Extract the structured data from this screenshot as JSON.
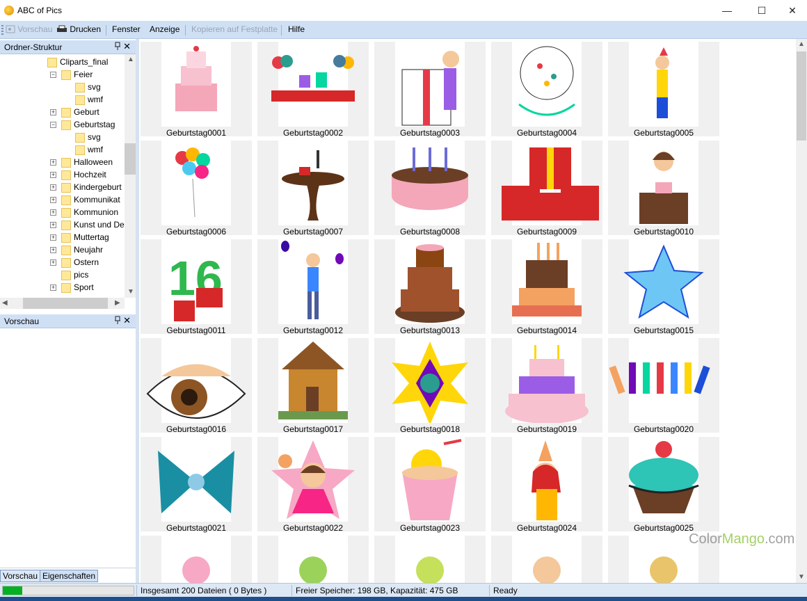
{
  "window": {
    "title": "ABC of Pics",
    "minimize_glyph": "—",
    "maximize_glyph": "☐",
    "close_glyph": "✕"
  },
  "menu": {
    "preview": "Vorschau",
    "print": "Drucken",
    "window": "Fenster",
    "view": "Anzeige",
    "copy_to_disk": "Kopieren auf Festplatte",
    "help": "Hilfe"
  },
  "folder_panel": {
    "title": "Ordner-Struktur",
    "pin_glyph": "📌",
    "close_glyph": "✕",
    "tree": [
      {
        "label": "Cliparts_final",
        "expander": ""
      },
      {
        "label": "Feier",
        "expander": "−"
      },
      {
        "label": "svg",
        "expander": ""
      },
      {
        "label": "wmf",
        "expander": ""
      },
      {
        "label": "Geburt",
        "expander": "+"
      },
      {
        "label": "Geburtstag",
        "expander": "−"
      },
      {
        "label": "svg",
        "expander": ""
      },
      {
        "label": "wmf",
        "expander": ""
      },
      {
        "label": "Halloween",
        "expander": "+"
      },
      {
        "label": "Hochzeit",
        "expander": "+"
      },
      {
        "label": "Kindergeburt",
        "expander": "+"
      },
      {
        "label": "Kommunikat",
        "expander": "+"
      },
      {
        "label": "Kommunion",
        "expander": "+"
      },
      {
        "label": "Kunst und De",
        "expander": "+"
      },
      {
        "label": "Muttertag",
        "expander": "+"
      },
      {
        "label": "Neujahr",
        "expander": "+"
      },
      {
        "label": "Ostern",
        "expander": "+"
      },
      {
        "label": "pics",
        "expander": ""
      },
      {
        "label": "Sport",
        "expander": "+"
      }
    ]
  },
  "preview_panel": {
    "title": "Vorschau",
    "pin_glyph": "📌",
    "close_glyph": "✕"
  },
  "bottom_tabs": {
    "preview": "Vorschau",
    "properties": "Eigenschaften"
  },
  "thumbnails": [
    "Geburtstag0001",
    "Geburtstag0002",
    "Geburtstag0003",
    "Geburtstag0004",
    "Geburtstag0005",
    "Geburtstag0006",
    "Geburtstag0007",
    "Geburtstag0008",
    "Geburtstag0009",
    "Geburtstag0010",
    "Geburtstag0011",
    "Geburtstag0012",
    "Geburtstag0013",
    "Geburtstag0014",
    "Geburtstag0015",
    "Geburtstag0016",
    "Geburtstag0017",
    "Geburtstag0018",
    "Geburtstag0019",
    "Geburtstag0020",
    "Geburtstag0021",
    "Geburtstag0022",
    "Geburtstag0023",
    "Geburtstag0024",
    "Geburtstag0025"
  ],
  "status": {
    "progress": 0.15,
    "files": "Insgesamt 200 Dateien ( 0 Bytes )",
    "space": "Freier Speicher: 198 GB, Kapazität: 475 GB",
    "state": "Ready"
  },
  "watermark": {
    "part1": "Color",
    "part2": "Mango",
    "part3": ".com"
  },
  "colors": {
    "menubar": "#cfe0f5",
    "progress": "#06b025",
    "thumb_bg": "#f0f0f0"
  }
}
